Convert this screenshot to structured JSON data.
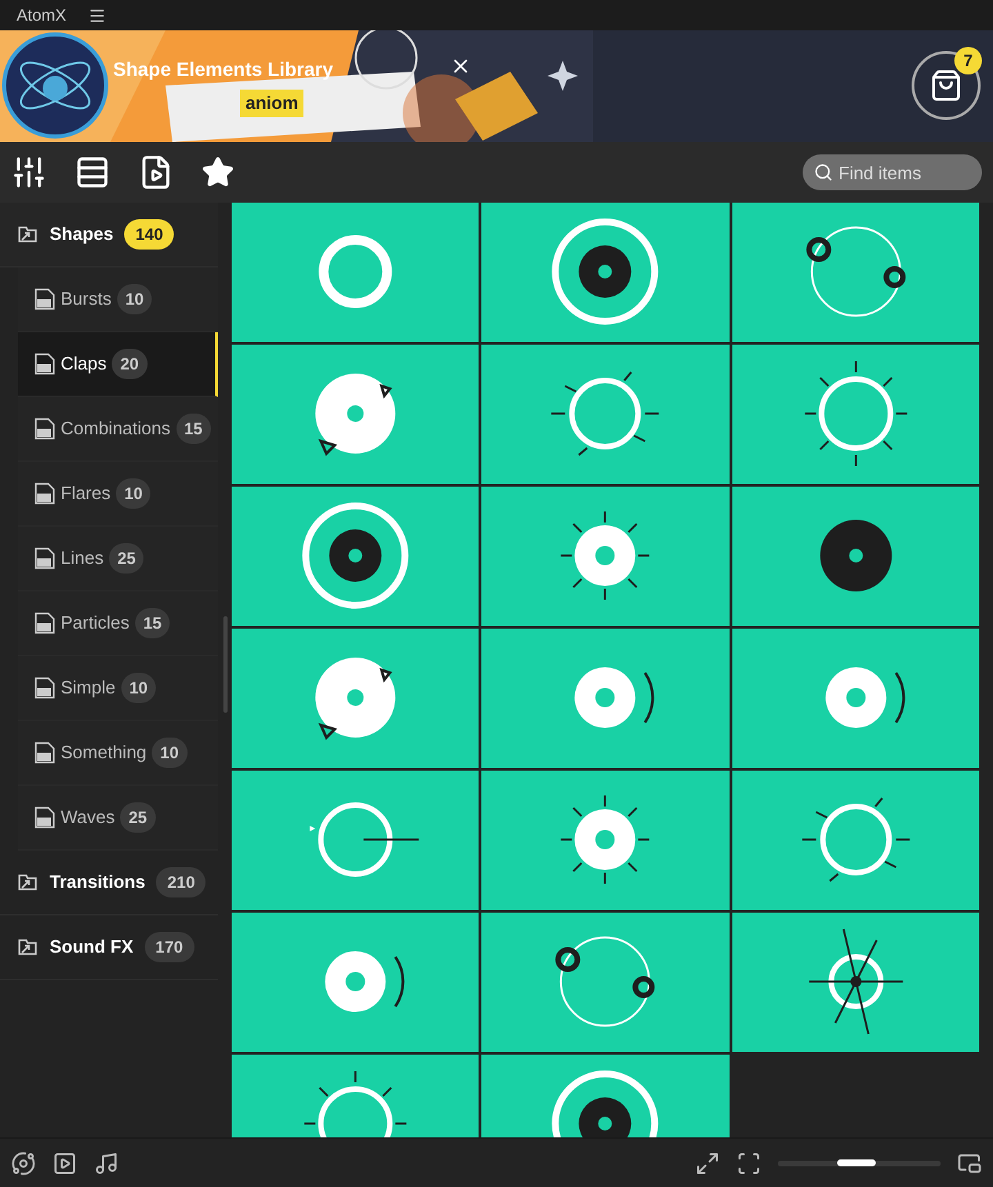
{
  "window": {
    "title": "AtomX"
  },
  "banner": {
    "title": "Shape Elements Library",
    "author": "aniom",
    "cart_count": "7"
  },
  "search": {
    "placeholder": "Find items"
  },
  "sidebar": {
    "items": [
      {
        "label": "Shapes",
        "count": "140",
        "expanded": true,
        "children": [
          {
            "label": "Bursts",
            "count": "10",
            "selected": false
          },
          {
            "label": "Claps",
            "count": "20",
            "selected": true
          },
          {
            "label": "Combinations",
            "count": "15",
            "selected": false
          },
          {
            "label": "Flares",
            "count": "10",
            "selected": false
          },
          {
            "label": "Lines",
            "count": "25",
            "selected": false
          },
          {
            "label": "Particles",
            "count": "15",
            "selected": false
          },
          {
            "label": "Simple",
            "count": "10",
            "selected": false
          },
          {
            "label": "Something",
            "count": "10",
            "selected": false
          },
          {
            "label": "Waves",
            "count": "25",
            "selected": false
          }
        ]
      },
      {
        "label": "Transitions",
        "count": "210",
        "expanded": false
      },
      {
        "label": "Sound FX",
        "count": "170",
        "expanded": false
      }
    ]
  },
  "tiles": [
    {
      "kind": "ring"
    },
    {
      "kind": "target"
    },
    {
      "kind": "orbit"
    },
    {
      "kind": "triangles"
    },
    {
      "kind": "dashes"
    },
    {
      "kind": "spikes"
    },
    {
      "kind": "target"
    },
    {
      "kind": "sun"
    },
    {
      "kind": "disc"
    },
    {
      "kind": "triangles"
    },
    {
      "kind": "arcs"
    },
    {
      "kind": "arcs"
    },
    {
      "kind": "line"
    },
    {
      "kind": "sun"
    },
    {
      "kind": "dashes"
    },
    {
      "kind": "arcs"
    },
    {
      "kind": "orbit"
    },
    {
      "kind": "cross"
    },
    {
      "kind": "spikes"
    },
    {
      "kind": "target"
    }
  ],
  "zoom": {
    "level": 0.48
  }
}
